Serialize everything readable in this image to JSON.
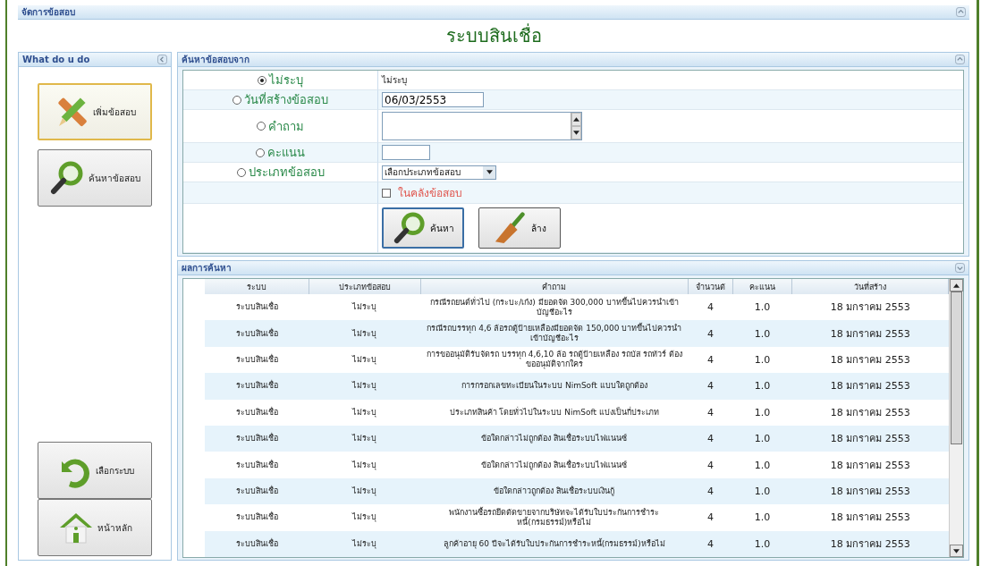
{
  "header": {
    "title": "จัดการข้อสอบ"
  },
  "page_title": "ระบบสินเชื่อ",
  "sidebar": {
    "title": "What do u do",
    "buttons": [
      {
        "label": "เพิ่มข้อสอบ",
        "kind": "add",
        "selected": true
      },
      {
        "label": "ค้นหาข้อสอบ",
        "kind": "search",
        "selected": false
      },
      {
        "label": "เลือกระบบ",
        "kind": "back",
        "selected": false
      },
      {
        "label": "หน้าหลัก",
        "kind": "home",
        "selected": false
      }
    ]
  },
  "search_panel": {
    "title": "ค้นหาข้อสอบจาก",
    "rows": [
      {
        "label": "ไม่ระบุ",
        "selected": true,
        "kind": "text",
        "value": "ไม่ระบุ"
      },
      {
        "label": "วันที่สร้างข้อสอบ",
        "selected": false,
        "kind": "date",
        "value": "06/03/2553"
      },
      {
        "label": "คำถาม",
        "selected": false,
        "kind": "textarea"
      },
      {
        "label": "คะแนน",
        "selected": false,
        "kind": "number"
      },
      {
        "label": "ประเภทข้อสอบ",
        "selected": false,
        "kind": "select",
        "value": "เลือกประเภทข้อสอบ"
      }
    ],
    "checkbox": {
      "label": "ในคลังข้อสอบ",
      "checked": false
    },
    "buttons": [
      {
        "label": "ค้นหา",
        "kind": "search",
        "selected": true
      },
      {
        "label": "ล้าง",
        "kind": "clear",
        "selected": false
      }
    ]
  },
  "results": {
    "title": "ผลการค้นหา",
    "columns": [
      "ระบบ",
      "ประเภทข้อสอบ",
      "คำถาม",
      "จำนวนตั",
      "คะแนน",
      "วันที่สร้าง"
    ],
    "rows": [
      [
        "ระบบสินเชื่อ",
        "ไม่ระบุ",
        "กรณีรถยนต์ทั่วไป (กระบะ/เก๋ง) มียอดจัด 300,000 บาทขึ้นไปควรนำเข้าบัญชีอะไร",
        "4",
        "1.0",
        "18 มกราคม 2553"
      ],
      [
        "ระบบสินเชื่อ",
        "ไม่ระบุ",
        "กรณีรถบรรทุก 4,6 ล้อรถตู้ป้ายเหลืองมียอดจัด 150,000 บาทขึ้นไปควรนำเข้าบัญชีอะไร",
        "4",
        "1.0",
        "18 มกราคม 2553"
      ],
      [
        "ระบบสินเชื่อ",
        "ไม่ระบุ",
        "การขออนุมัติรับจัดรถ บรรทุก 4,6,10 ล้อ รถตู้ป้ายเหลือง รถบัส รถทัวร์ ต้องขออนุมัติจากใคร",
        "4",
        "1.0",
        "18 มกราคม 2553"
      ],
      [
        "ระบบสินเชื่อ",
        "ไม่ระบุ",
        "การกรอกเลขทะเบียนในระบบ NimSoft แบบใดถูกต้อง",
        "4",
        "1.0",
        "18 มกราคม 2553"
      ],
      [
        "ระบบสินเชื่อ",
        "ไม่ระบุ",
        "ประเภทสินค้า โดยทั่วไปในระบบ NimSoft แบ่งเป็นกี่ประเภท",
        "4",
        "1.0",
        "18 มกราคม 2553"
      ],
      [
        "ระบบสินเชื่อ",
        "ไม่ระบุ",
        "ข้อใดกล่าวไม่ถูกต้อง สินเชื่อระบบไฟแนนซ์",
        "4",
        "1.0",
        "18 มกราคม 2553"
      ],
      [
        "ระบบสินเชื่อ",
        "ไม่ระบุ",
        "ข้อใดกล่าวไม่ถูกต้อง สินเชื่อระบบไฟแนนซ์",
        "4",
        "1.0",
        "18 มกราคม 2553"
      ],
      [
        "ระบบสินเชื่อ",
        "ไม่ระบุ",
        "ข้อใดกล่าวถูกต้อง สินเชื่อระบบเงินกู้",
        "4",
        "1.0",
        "18 มกราคม 2553"
      ],
      [
        "ระบบสินเชื่อ",
        "ไม่ระบุ",
        "พนักงานซื้อรถยึดตัดขายจากบริษัทจะได้รับใบประกันการชำระหนี้(กรมธรรม์)หรือไม่",
        "4",
        "1.0",
        "18 มกราคม 2553"
      ],
      [
        "ระบบสินเชื่อ",
        "ไม่ระบุ",
        "ลูกค้าอายุ 60 ปีจะได้รับใบประกันการชำระหนี้(กรมธรรม์)หรือไม่",
        "4",
        "1.0",
        "18 มกราคม 2553"
      ]
    ]
  }
}
